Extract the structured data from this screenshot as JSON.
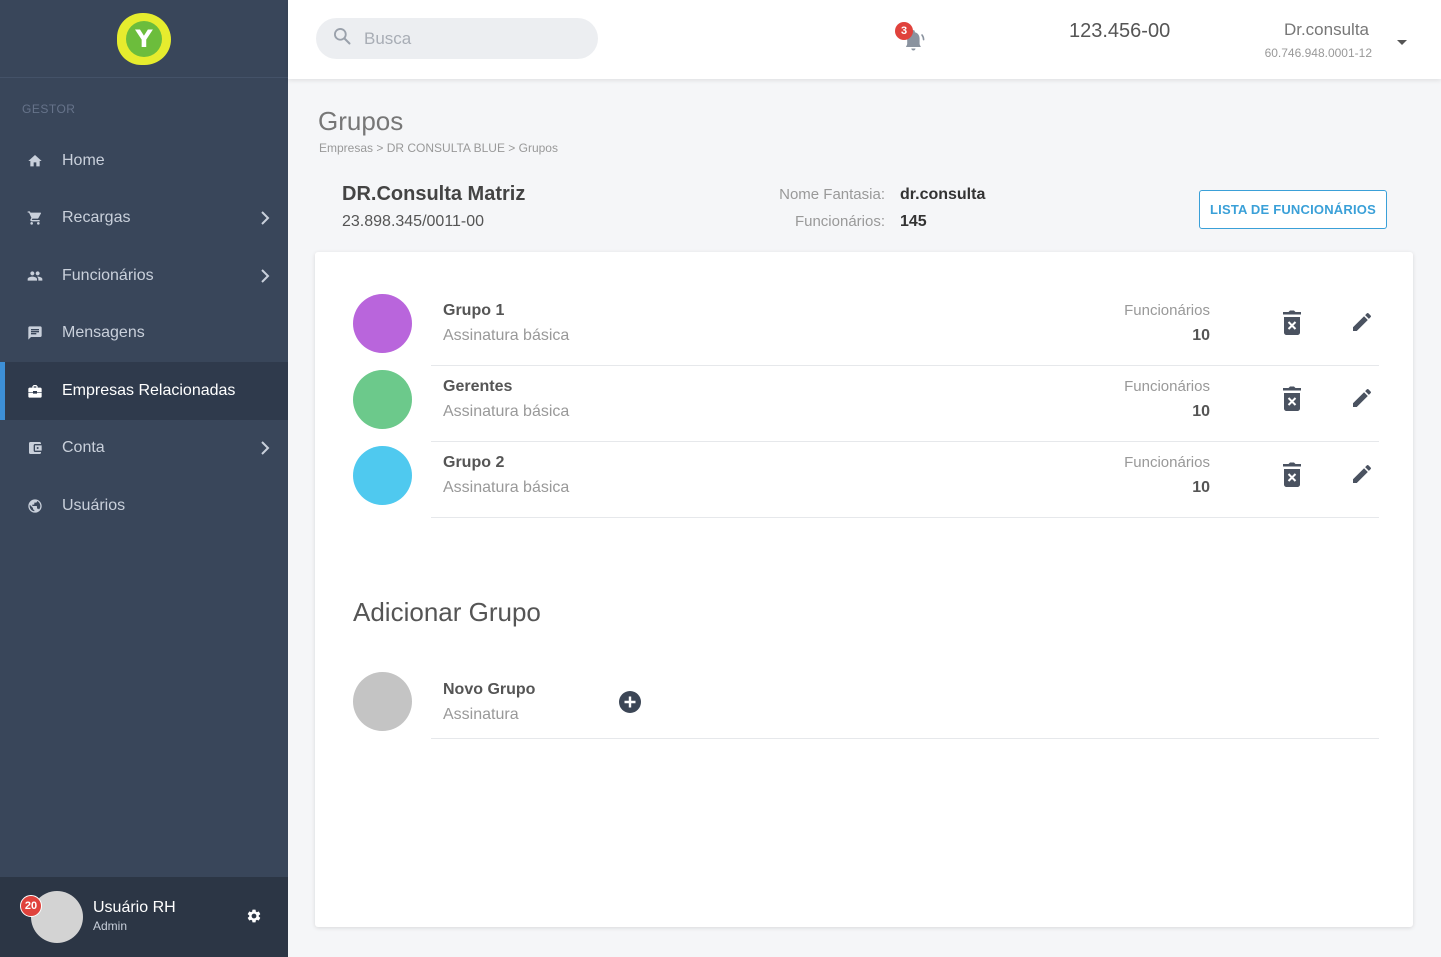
{
  "sidebar": {
    "logo_letter": "Y",
    "section_label": "GESTOR",
    "items": [
      {
        "label": "Home",
        "icon": "home-icon"
      },
      {
        "label": "Recargas",
        "icon": "cart-icon"
      },
      {
        "label": "Funcionários",
        "icon": "people-icon"
      },
      {
        "label": "Mensagens",
        "icon": "message-icon"
      },
      {
        "label": "Empresas Relacionadas",
        "icon": "briefcase-icon"
      },
      {
        "label": "Conta",
        "icon": "wallet-icon"
      },
      {
        "label": "Usuários",
        "icon": "globe-icon"
      }
    ],
    "user": {
      "name": "Usuário RH",
      "role": "Admin",
      "badge": "20"
    }
  },
  "topbar": {
    "search_placeholder": "Busca",
    "notif_count": "3",
    "account_number": "123.456-00",
    "account_name": "Dr.consulta",
    "account_doc": "60.746.948.0001-12"
  },
  "page": {
    "title": "Grupos",
    "breadcrumb": "Empresas > DR CONSULTA BLUE > Grupos"
  },
  "company": {
    "name": "DR.Consulta Matriz",
    "cnpj": "23.898.345/0011-00",
    "fantasia_label": "Nome Fantasia:",
    "fantasia_value": "dr.consulta",
    "funcionarios_label": "Funcionários:",
    "funcionarios_value": "145",
    "list_button": "LISTA DE FUNCIONÁRIOS"
  },
  "groups": [
    {
      "name": "Grupo 1",
      "plan": "Assinatura básica",
      "count_label": "Funcionários",
      "count": "10",
      "color": "#b965dc"
    },
    {
      "name": "Gerentes",
      "plan": "Assinatura básica",
      "count_label": "Funcionários",
      "count": "10",
      "color": "#6cc98b"
    },
    {
      "name": "Grupo 2",
      "plan": "Assinatura básica",
      "count_label": "Funcionários",
      "count": "10",
      "color": "#4fc9ef"
    }
  ],
  "add_group": {
    "title": "Adicionar Grupo",
    "name": "Novo Grupo",
    "plan": "Assinatura",
    "color": "#c4c4c4"
  }
}
